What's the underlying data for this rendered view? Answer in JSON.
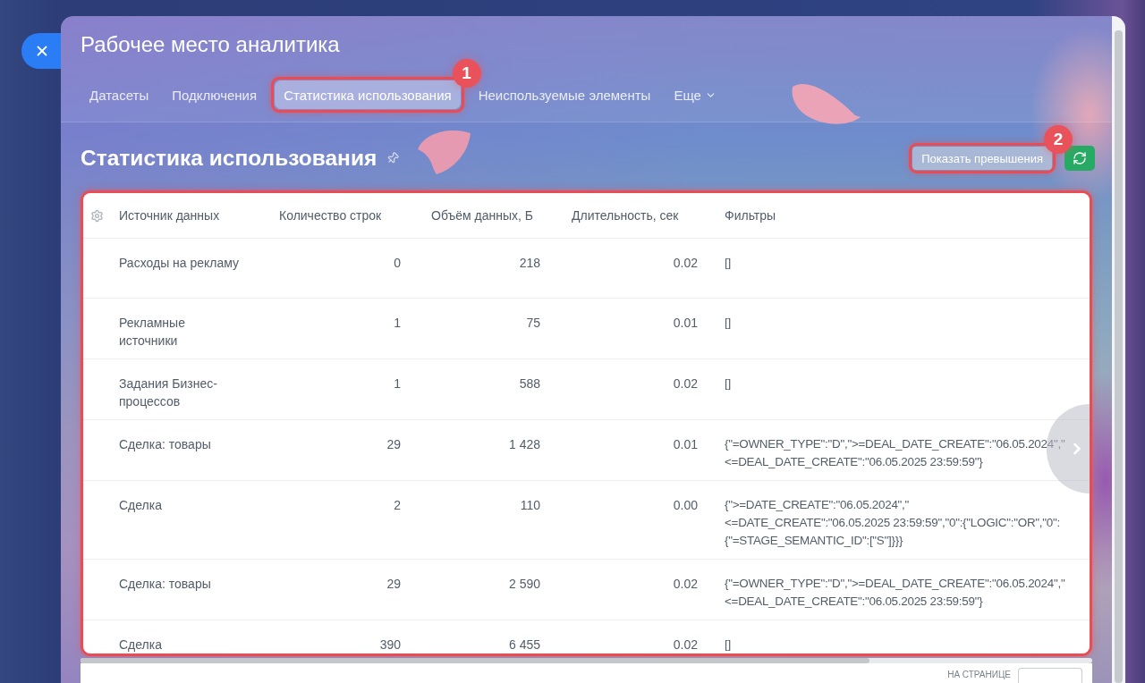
{
  "window": {
    "title": "Рабочее место аналитика"
  },
  "tabs": [
    {
      "label": "Датасеты",
      "selected": false,
      "highlighted": false
    },
    {
      "label": "Подключения",
      "selected": false,
      "highlighted": false
    },
    {
      "label": "Статистика использования",
      "selected": true,
      "highlighted": true,
      "badge": "1"
    },
    {
      "label": "Неиспользуемые элементы",
      "selected": false,
      "highlighted": false
    }
  ],
  "more_menu": {
    "label": "Еще"
  },
  "page": {
    "title": "Статистика использования"
  },
  "toolbar": [
    {
      "kind": "text",
      "label": "Показать превышения",
      "highlighted": true,
      "badge": "2"
    },
    {
      "kind": "refresh",
      "highlighted": false
    }
  ],
  "table": {
    "highlighted": true,
    "columns": [
      "Источник данных",
      "Количество строк",
      "Объём данных, Б",
      "Длительность, сек",
      "Фильтры"
    ],
    "rows": [
      {
        "source": "Расходы на рекламу",
        "row_count": "0",
        "data_volume": "218",
        "duration": "0.02",
        "filters": "[]"
      },
      {
        "source": "Рекламные источники",
        "row_count": "1",
        "data_volume": "75",
        "duration": "0.01",
        "filters": "[]"
      },
      {
        "source": "Задания Бизнес-процессов",
        "row_count": "1",
        "data_volume": "588",
        "duration": "0.02",
        "filters": "[]"
      },
      {
        "source": "Сделка: товары",
        "row_count": "29",
        "data_volume": "1 428",
        "duration": "0.01",
        "filters": "{\"=OWNER_TYPE\":\"D\",\">=DEAL_DATE_CREATE\":\"06.05.2024\",\"<=DEAL_DATE_CREATE\":\"06.05.2025 23:59:59\"}"
      },
      {
        "source": "Сделка",
        "row_count": "2",
        "data_volume": "110",
        "duration": "0.00",
        "filters": "{\">=DATE_CREATE\":\"06.05.2024\",\"<=DATE_CREATE\":\"06.05.2025 23:59:59\",\"0\":{\"LOGIC\":\"OR\",\"0\":{\"=STAGE_SEMANTIC_ID\":[\"S\"]}}}"
      },
      {
        "source": "Сделка: товары",
        "row_count": "29",
        "data_volume": "2 590",
        "duration": "0.02",
        "filters": "{\"=OWNER_TYPE\":\"D\",\">=DEAL_DATE_CREATE\":\"06.05.2024\",\"<=DEAL_DATE_CREATE\":\"06.05.2025 23:59:59\"}"
      },
      {
        "source": "Сделка",
        "row_count": "390",
        "data_volume": "6 455",
        "duration": "0.02",
        "filters": "[]"
      }
    ]
  },
  "footer": {
    "page_size_label": "НА СТРАНИЦЕ"
  }
}
